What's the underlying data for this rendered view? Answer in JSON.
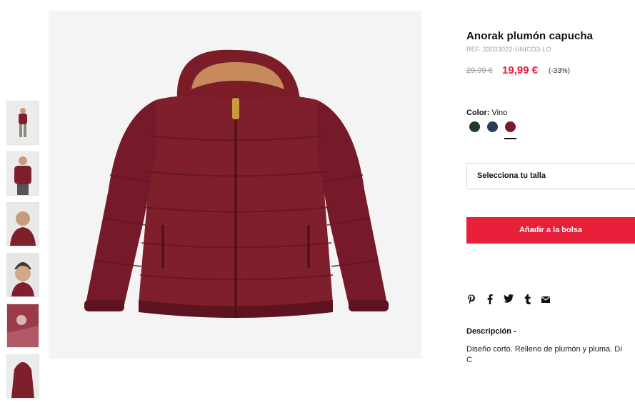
{
  "product": {
    "title": "Anorak plumón capucha",
    "ref": "REF. 33033022-UNICO3-LO",
    "old_price": "29,99 €",
    "new_price": "19,99 €",
    "discount": "(-33%)",
    "color_label": "Color:",
    "color_value": "Vino"
  },
  "colors": {
    "swatches": [
      "#1f3a27",
      "#2a3a5a",
      "#7a1b2c"
    ],
    "accent": "#e8203a",
    "jacket": "#7e1f2b"
  },
  "size": {
    "placeholder": "Selecciona tu talla"
  },
  "actions": {
    "add_to_bag": "Añadir a la bolsa"
  },
  "share": {
    "icons": [
      "pinterest-icon",
      "facebook-icon",
      "twitter-icon",
      "tumblr-icon",
      "mail-icon"
    ]
  },
  "description": {
    "title": "Descripción -",
    "line1": "Diseño corto. Relleno de plumón y pluma. Di",
    "line2": "C"
  }
}
